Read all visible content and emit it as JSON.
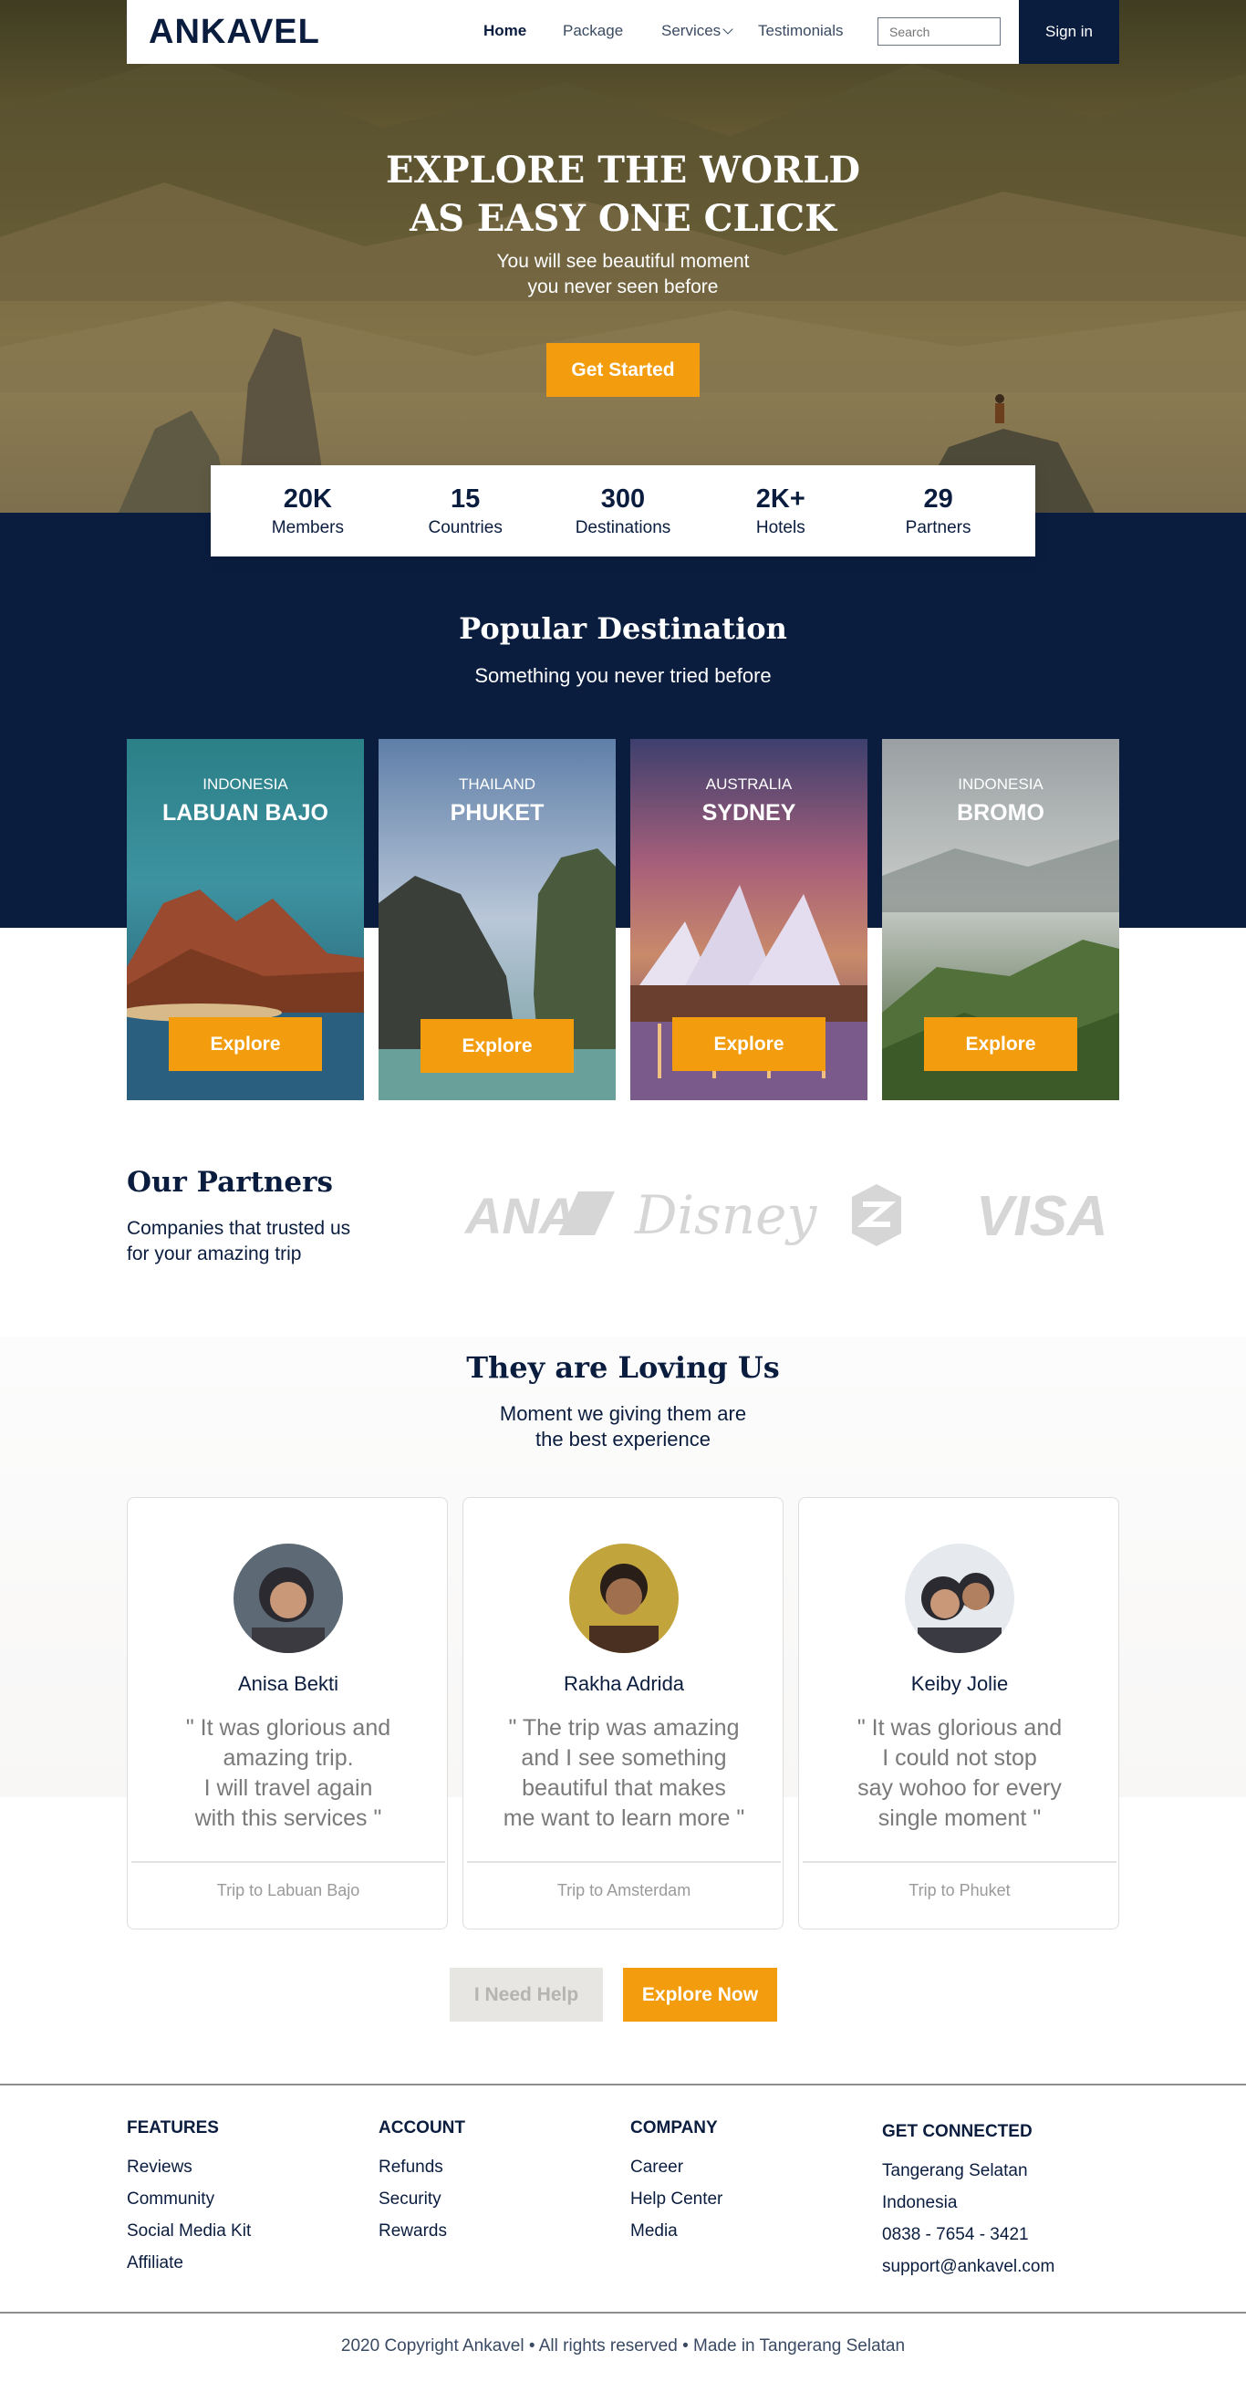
{
  "brand": {
    "logo": "ANKAVEL"
  },
  "nav": {
    "home": "Home",
    "package": "Package",
    "services": "Services",
    "testimonials": "Testimonials",
    "search_placeholder": "Search",
    "signin": "Sign in"
  },
  "hero": {
    "title_line1": "EXPLORE THE WORLD",
    "title_line2": "AS EASY ONE CLICK",
    "subtitle_line1": "You will see beautiful moment",
    "subtitle_line2": "you never seen before",
    "cta": "Get Started"
  },
  "stats": [
    {
      "value": "20K",
      "label": "Members"
    },
    {
      "value": "15",
      "label": "Countries"
    },
    {
      "value": "300",
      "label": "Destinations"
    },
    {
      "value": "2K+",
      "label": "Hotels"
    },
    {
      "value": "29",
      "label": "Partners"
    }
  ],
  "popular": {
    "title": "Popular Destination",
    "subtitle": "Something you never tried before",
    "destinations": [
      {
        "country": "INDONESIA",
        "city": "LABUAN BAJO",
        "button": "Explore"
      },
      {
        "country": "THAILAND",
        "city": "PHUKET",
        "button": "Explore"
      },
      {
        "country": "AUSTRALIA",
        "city": "SYDNEY",
        "button": "Explore"
      },
      {
        "country": "INDONESIA",
        "city": "BROMO",
        "button": "Explore"
      }
    ]
  },
  "partners": {
    "title": "Our Partners",
    "subtitle_line1": "Companies that trusted us",
    "subtitle_line2": "for your amazing trip",
    "logos": [
      "ANA",
      "Disney",
      "VISA"
    ]
  },
  "testimonials": {
    "title": "They are Loving Us",
    "subtitle_line1": "Moment we giving them are",
    "subtitle_line2": "the best experience",
    "items": [
      {
        "name": "Anisa Bekti",
        "quote": "\" It was glorious and\namazing trip.\nI will travel again\nwith this services \"",
        "trip": "Trip to Labuan Bajo"
      },
      {
        "name": "Rakha Adrida",
        "quote": "\" The trip was amazing\nand I see something\nbeautiful that makes\nme want to learn more \"",
        "trip": "Trip to Amsterdam"
      },
      {
        "name": "Keiby Jolie",
        "quote": "\" It was glorious and\nI could not stop\nsay wohoo for every\nsingle moment  \"",
        "trip": "Trip to Phuket"
      }
    ]
  },
  "cta": {
    "help": "I Need Help",
    "explore": "Explore Now"
  },
  "footer": {
    "columns": [
      {
        "heading": "FEATURES",
        "items": [
          "Reviews",
          "Community",
          "Social Media Kit",
          "Affiliate"
        ]
      },
      {
        "heading": "ACCOUNT",
        "items": [
          "Refunds",
          "Security",
          "Rewards"
        ]
      },
      {
        "heading": "COMPANY",
        "items": [
          "Career",
          "Help Center",
          "Media"
        ]
      },
      {
        "heading": "GET CONNECTED",
        "items": [
          "Tangerang Selatan",
          "Indonesia",
          "0838 - 7654 - 3421",
          "support@ankavel.com"
        ]
      }
    ],
    "copyright": "2020 Copyright Ankavel • All rights reserved • Made in Tangerang Selatan"
  },
  "colors": {
    "navy": "#0b1d3f",
    "accent": "#f39c0e",
    "muted": "#7a7a7a"
  }
}
